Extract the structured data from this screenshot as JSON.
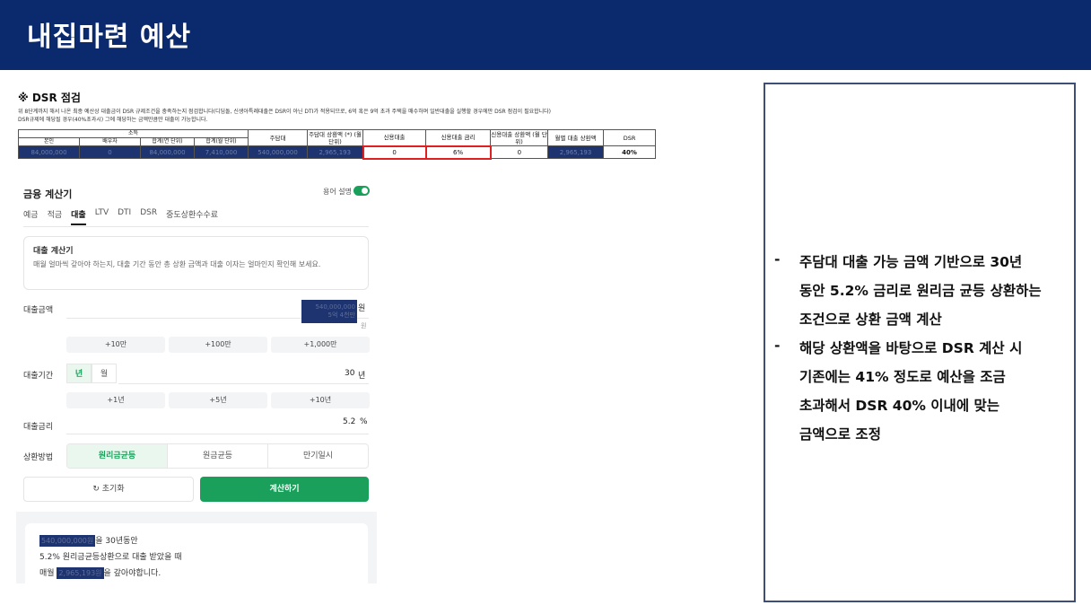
{
  "header": {
    "title": "내집마련 예산"
  },
  "dsr": {
    "title": "※ DSR 점검",
    "note1": "위 8단계까지 해서 나온 최종 예산상 대출금이 DSR 규제조건을 충족하는지 점검합니다(디딤돌, 신생아특례대출은 DSR이 아닌 DTI가 적용되므로, 6억 혹은 9억 초과 주택을 매수하며 일반대출을 실행할 경우에만 DSR 점검이 필요합니다)",
    "note2": "DSR규제에 해당될 경우(40%초과시) 그에 해당하는 금액만큼만 대출이 가능합니다.",
    "table": {
      "income_group": "소득",
      "h_self": "본인",
      "h_spouse": "배우자",
      "h_total_year": "합계(연 단위)",
      "h_total_month": "합계(월 단위)",
      "h_mortgage": "주담대",
      "h_mortgage_repay": "주담대 상환액 (*) (월 단위)",
      "h_credit": "신용대출",
      "h_credit_rate": "신용대출 금리",
      "h_credit_repay": "신용대출 상환액 (월 단위)",
      "h_monthly_repay": "월별 대출 상환액",
      "h_dsr": "DSR",
      "v_self": "84,000,000",
      "v_spouse": "0",
      "v_total_year": "84,000,000",
      "v_total_month": "7,410,000",
      "v_mortgage": "540,000,000",
      "v_mortgage_repay": "2,965,193",
      "v_credit": "0",
      "v_credit_rate": "6%",
      "v_credit_repay": "0",
      "v_monthly_repay": "2,965,193",
      "v_dsr": "40%"
    }
  },
  "calculator": {
    "title": "금융 계산기",
    "term_toggle_label": "용어 설명",
    "tabs": [
      "예금",
      "적금",
      "대출",
      "LTV",
      "DTI",
      "DSR",
      "중도상환수수료"
    ],
    "active_tab": "대출",
    "info_title": "대출 계산기",
    "info_desc": "매월 얼마씩 갚아야 하는지, 대출 기간 동안 총 상환 금액과 대출 이자는 얼마인지 확인해 보세요.",
    "amount_label": "대출금액",
    "amount_value": "540,000,000",
    "amount_unit": "원",
    "amount_korean": "5억 4천만",
    "amount_unit_sub": "원",
    "amount_chips": [
      "+10만",
      "+100만",
      "+1,000만"
    ],
    "period_label": "대출기간",
    "period_units": [
      "년",
      "월"
    ],
    "period_value": "30",
    "period_unit": "년",
    "period_chips": [
      "+1년",
      "+5년",
      "+10년"
    ],
    "rate_label": "대출금리",
    "rate_value": "5.2",
    "rate_unit": "%",
    "method_label": "상환방법",
    "methods": [
      "원리금균등",
      "원금균등",
      "만기일시"
    ],
    "active_method": "원리금균등",
    "reset_label": "초기화",
    "calc_label": "계산하기",
    "result_amount": "540,000,000원",
    "result_line1_suffix": "을 30년동안",
    "result_line2": "5.2% 원리금균등상환으로 대출 받았을 때",
    "result_line3_prefix": "매월",
    "result_monthly": "2,965,193원",
    "result_line3_suffix": "을 갚아야합니다."
  },
  "panel": {
    "bullet": "-",
    "lines": [
      "주담대 대출 가능 금액 기반으로 30년",
      "동안 5.2% 금리로 원리금 균등 상환하는",
      "조건으로 상환 금액 계산",
      "해당 상환액을 바탕으로 DSR 계산 시",
      "기존에는 41% 정도로 예산을 조금",
      "초과해서 DSR 40% 이내에 맞는",
      "금액으로 조정"
    ]
  }
}
